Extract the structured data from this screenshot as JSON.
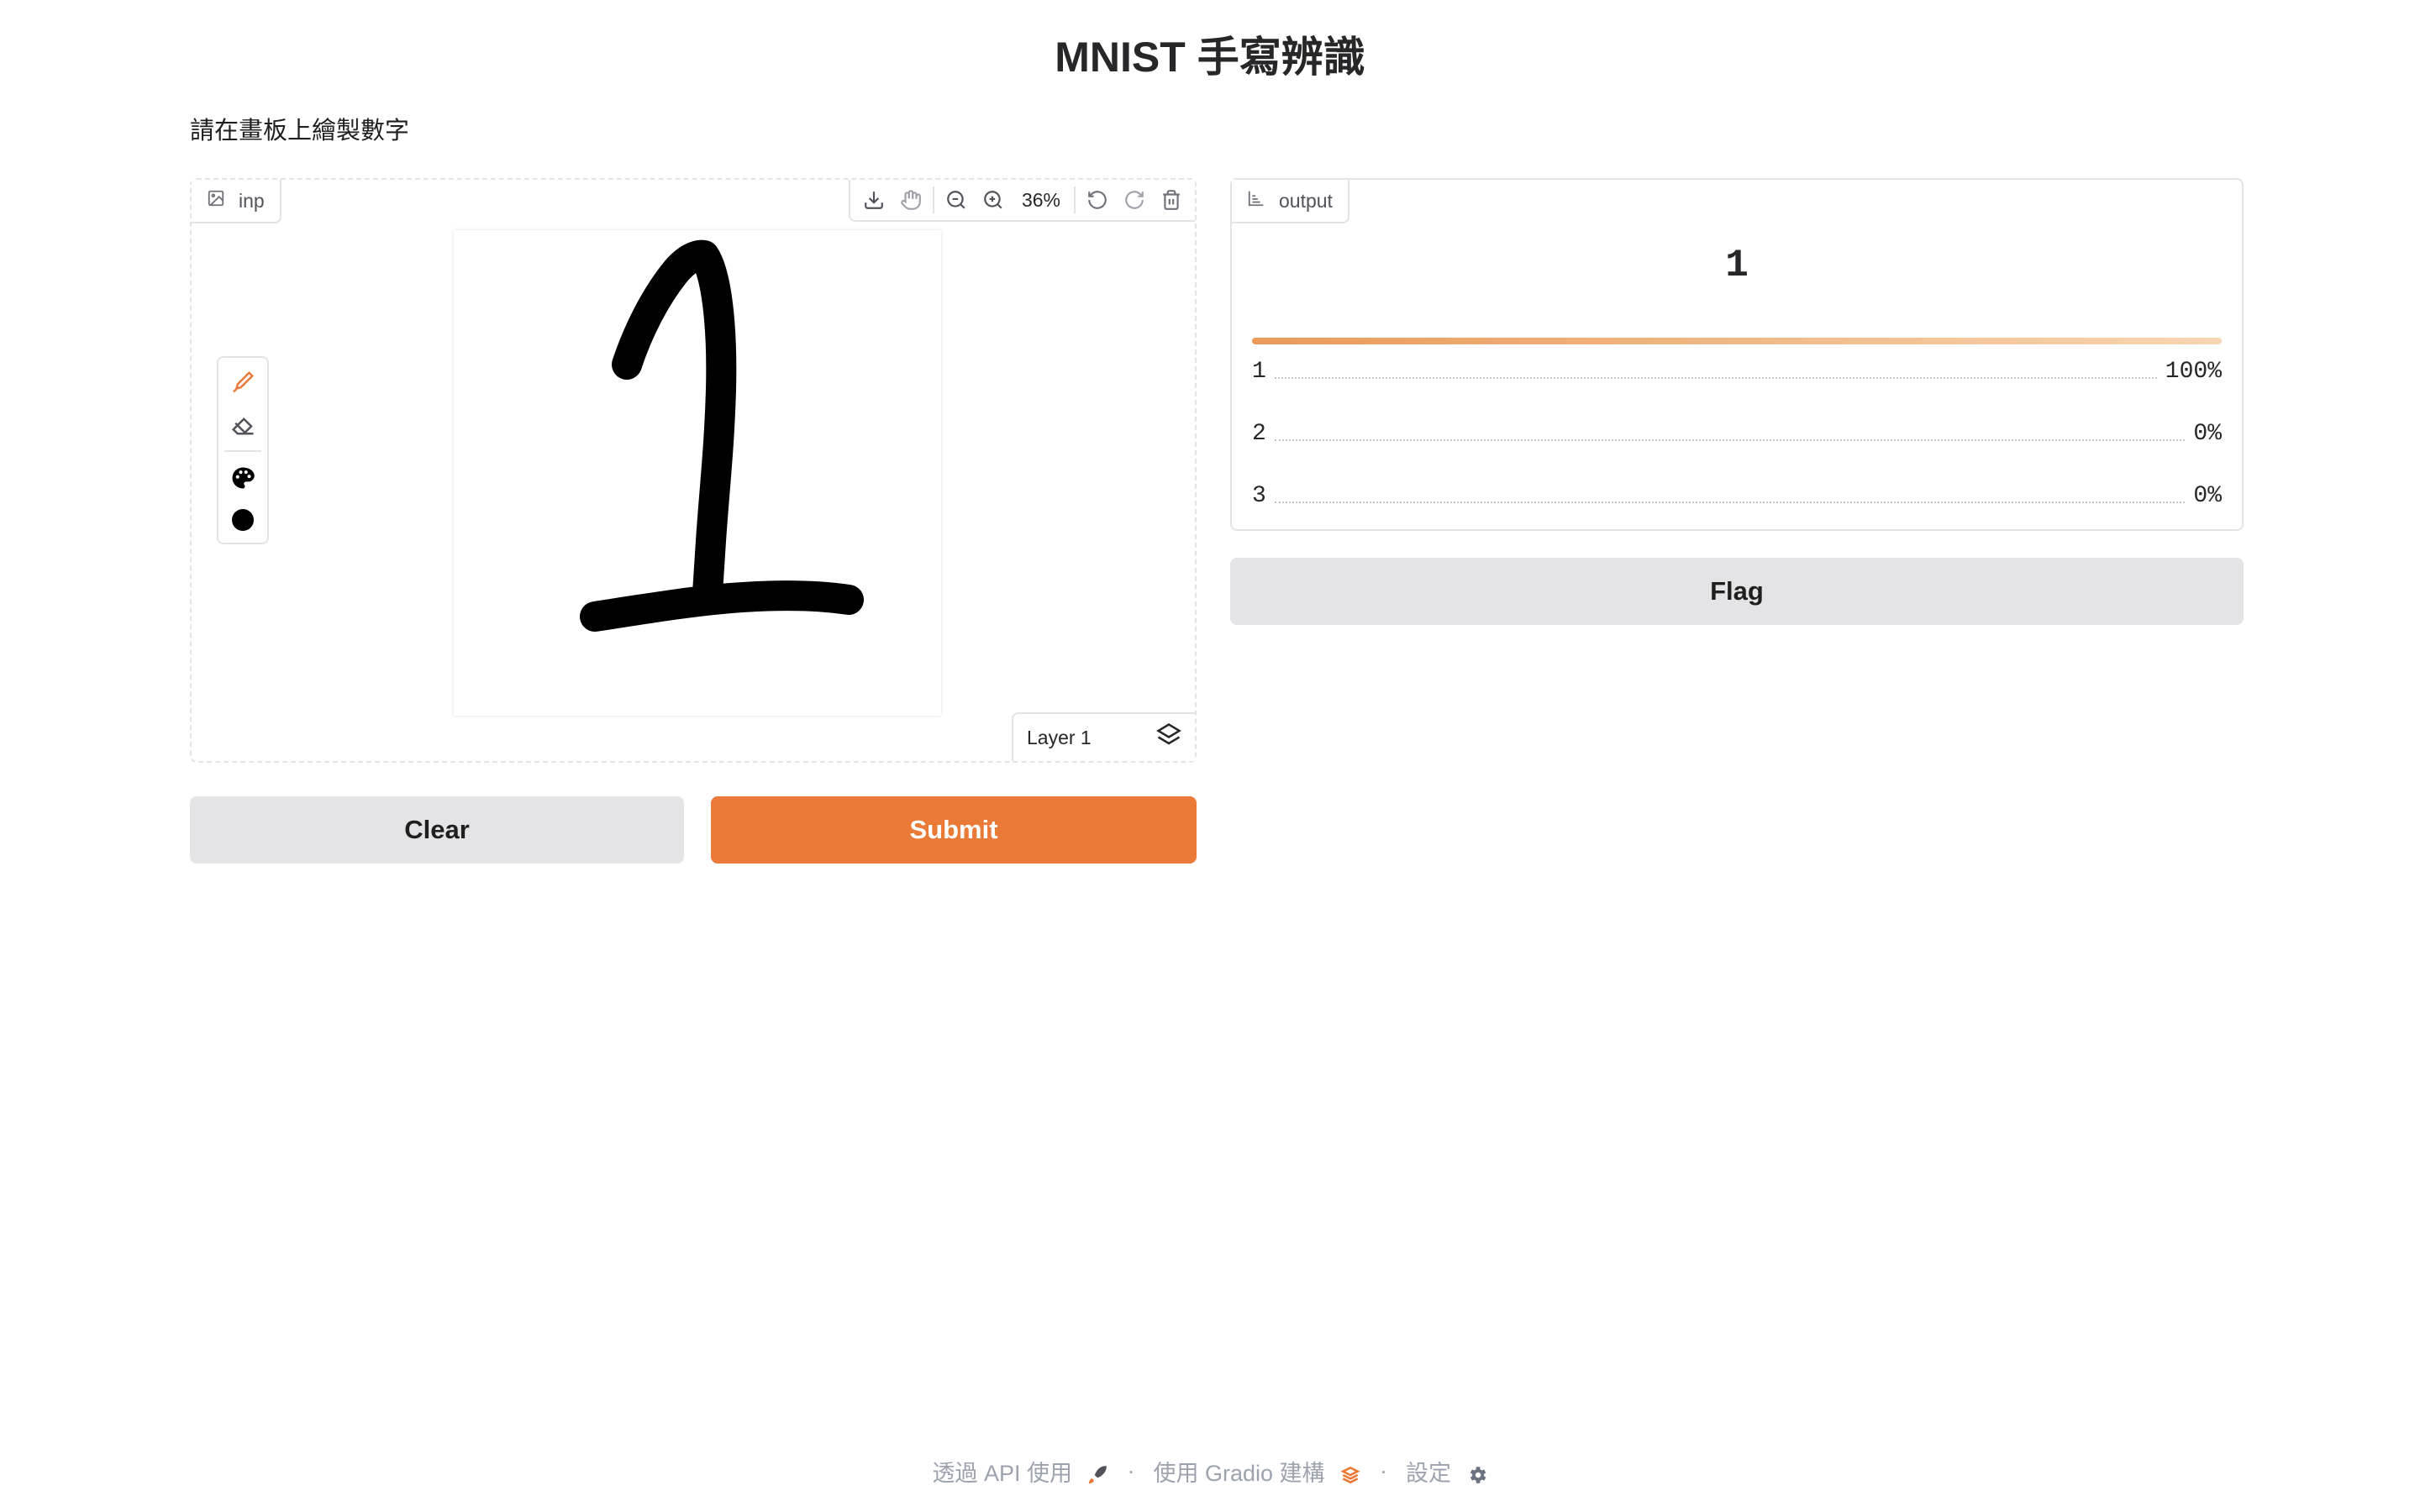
{
  "header": {
    "title": "MNIST 手寫辨識",
    "description": "請在畫板上繪製數字"
  },
  "input_panel": {
    "label": "inp",
    "toolbar": {
      "zoom_level": "36%"
    },
    "layer": {
      "name": "Layer 1"
    },
    "tools": [
      "brush-icon",
      "eraser-icon",
      "palette-icon",
      "color-dot-icon"
    ],
    "brush_color": "#000000"
  },
  "buttons": {
    "clear": "Clear",
    "submit": "Submit",
    "flag": "Flag"
  },
  "output_panel": {
    "label": "output",
    "prediction": "1",
    "top_confidence": 1.0,
    "confidences": [
      {
        "label": "1",
        "value": "100%"
      },
      {
        "label": "2",
        "value": "0%"
      },
      {
        "label": "3",
        "value": "0%"
      }
    ]
  },
  "footer": {
    "api": "透過 API 使用",
    "built_with": "使用 Gradio 建構",
    "settings": "設定"
  },
  "colors": {
    "accent": "#ea7a37",
    "secondary": "#e4e4e7",
    "border": "#e4e4e7"
  }
}
